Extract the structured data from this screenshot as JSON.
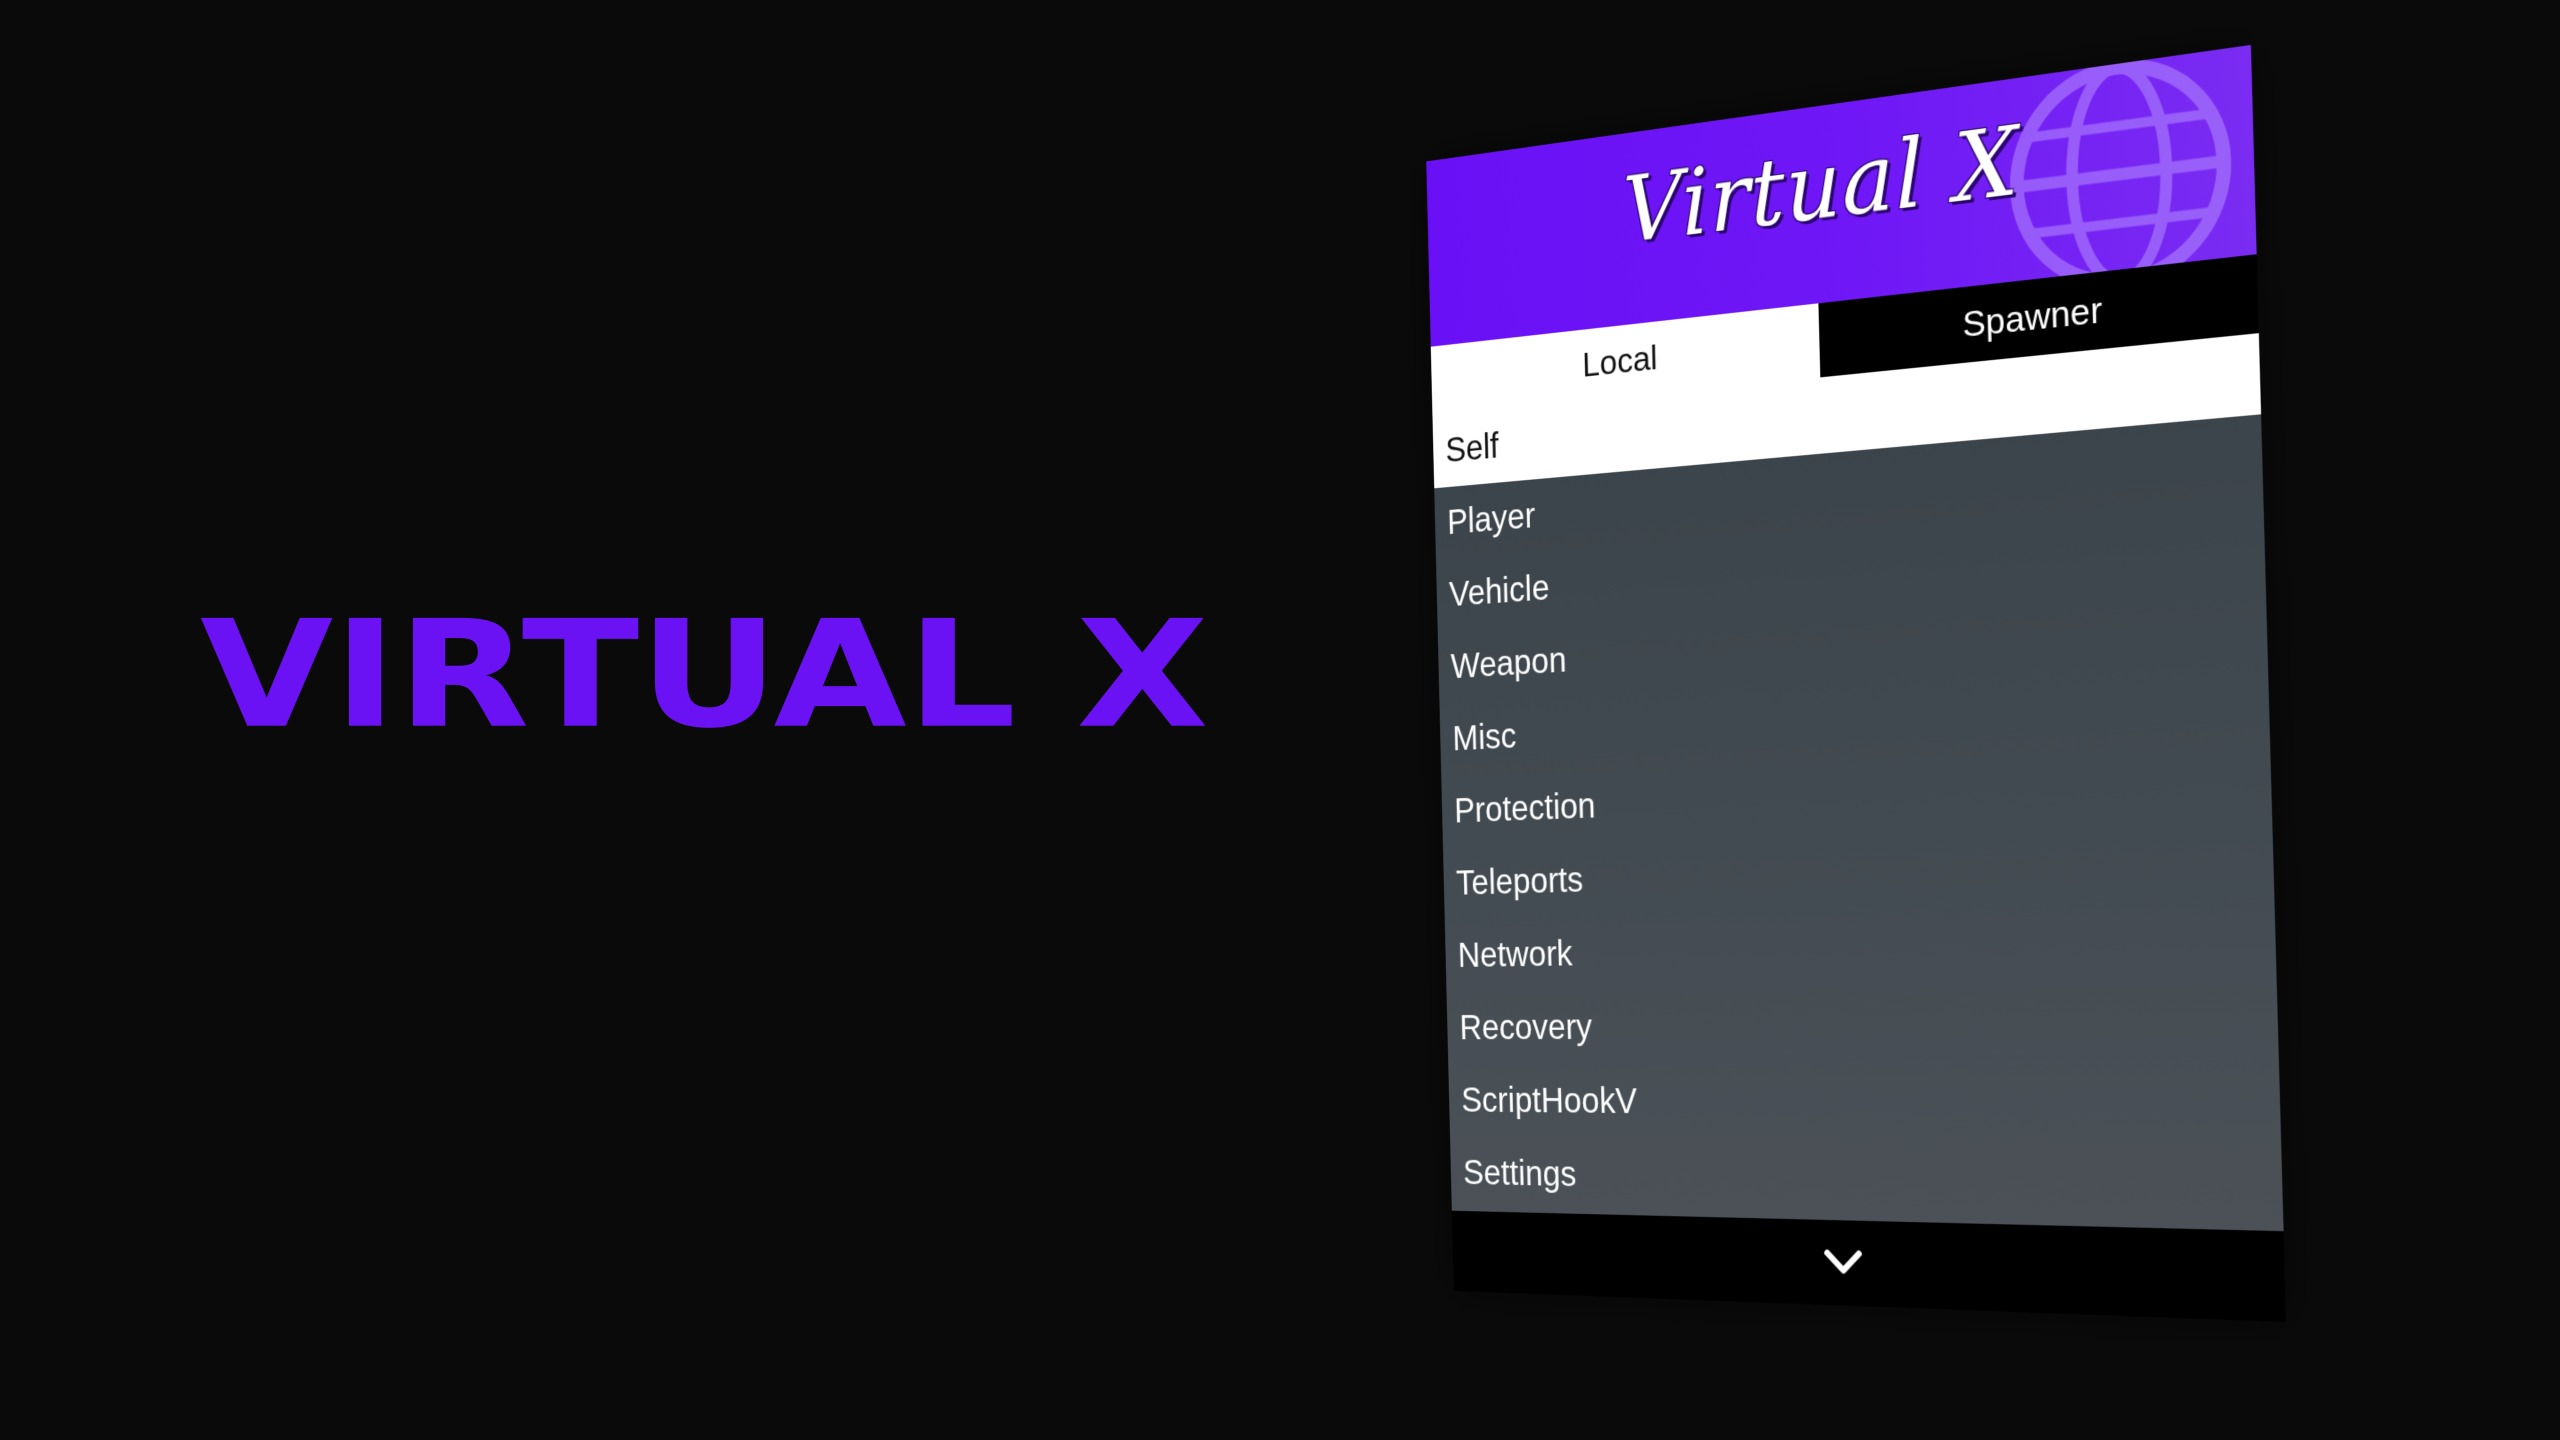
{
  "brand": {
    "wordmark": "VIRTUAL X",
    "accent_color": "#6b12f5"
  },
  "menu": {
    "title": "Virtual X",
    "header_icon": "globe-icon",
    "tabs": [
      {
        "label": "Local",
        "active": true
      },
      {
        "label": "Spawner",
        "active": false
      }
    ],
    "items": [
      {
        "label": "Self",
        "selected": true
      },
      {
        "label": "Player",
        "selected": false
      },
      {
        "label": "Vehicle",
        "selected": false
      },
      {
        "label": "Weapon",
        "selected": false
      },
      {
        "label": "Misc",
        "selected": false
      },
      {
        "label": "Protection",
        "selected": false
      },
      {
        "label": "Teleports",
        "selected": false
      },
      {
        "label": "Network",
        "selected": false
      },
      {
        "label": "Recovery",
        "selected": false
      },
      {
        "label": "ScriptHookV",
        "selected": false
      },
      {
        "label": "Settings",
        "selected": false
      }
    ],
    "footer_icon": "chevron-down-icon"
  }
}
